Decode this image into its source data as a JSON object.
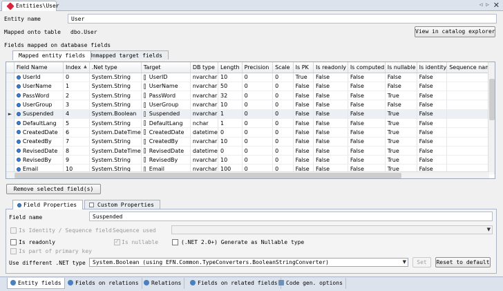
{
  "window": {
    "doc_tab": "Entities\\User",
    "nav_arrows": "◁ ▷",
    "close": "✕"
  },
  "entity": {
    "name_label": "Entity name",
    "name_value": "User",
    "mapped_label": "Mapped onto table",
    "mapped_value": "dbo.User",
    "view_catalog_button": "View in catalog explorer",
    "fields_section_label": "Fields mapped on database fields"
  },
  "field_tabs": [
    "Mapped entity fields",
    "Unmapped target fields"
  ],
  "grid": {
    "columns": [
      "Field Name",
      "Index",
      ".Net type",
      "Target",
      "DB type",
      "Length",
      "Precision",
      "Scale",
      "Is PK",
      "Is readonly",
      "Is computed",
      "Is nullable",
      "Is identity",
      "Sequence name"
    ],
    "sort_indicator": "▲",
    "current_marker": "►",
    "rows": [
      [
        "UserId",
        "0",
        "System.String",
        "UserID",
        "nvarchar",
        "10",
        "0",
        "0",
        "True",
        "False",
        "False",
        "False",
        "False",
        ""
      ],
      [
        "UserName",
        "1",
        "System.String",
        "UserName",
        "nvarchar",
        "50",
        "0",
        "0",
        "False",
        "False",
        "False",
        "False",
        "False",
        ""
      ],
      [
        "PassWord",
        "2",
        "System.String",
        "PassWord",
        "nvarchar",
        "32",
        "0",
        "0",
        "False",
        "False",
        "False",
        "True",
        "False",
        ""
      ],
      [
        "UserGroup",
        "3",
        "System.String",
        "UserGroup",
        "nvarchar",
        "10",
        "0",
        "0",
        "False",
        "False",
        "False",
        "False",
        "False",
        ""
      ],
      [
        "Suspended",
        "4",
        "System.Boolean",
        "Suspended",
        "nvarchar",
        "1",
        "0",
        "0",
        "False",
        "False",
        "False",
        "True",
        "False",
        ""
      ],
      [
        "DefaultLang",
        "5",
        "System.String",
        "DefaultLang",
        "nchar",
        "1",
        "0",
        "0",
        "False",
        "False",
        "False",
        "True",
        "False",
        ""
      ],
      [
        "CreatedDate",
        "6",
        "System.DateTime",
        "CreatedDate",
        "datetime",
        "0",
        "0",
        "0",
        "False",
        "False",
        "False",
        "True",
        "False",
        ""
      ],
      [
        "CreatedBy",
        "7",
        "System.String",
        "CreatedBy",
        "nvarchar",
        "10",
        "0",
        "0",
        "False",
        "False",
        "False",
        "True",
        "False",
        ""
      ],
      [
        "RevisedDate",
        "8",
        "System.DateTime",
        "RevisedDate",
        "datetime",
        "0",
        "0",
        "0",
        "False",
        "False",
        "False",
        "True",
        "False",
        ""
      ],
      [
        "RevisedBy",
        "9",
        "System.String",
        "RevisedBy",
        "nvarchar",
        "10",
        "0",
        "0",
        "False",
        "False",
        "False",
        "True",
        "False",
        ""
      ],
      [
        "Email",
        "10",
        "System.String",
        "Email",
        "nvarchar",
        "100",
        "0",
        "0",
        "False",
        "False",
        "False",
        "True",
        "False",
        ""
      ]
    ],
    "current_row_index": 4
  },
  "remove_button": "Remove selected field(s)",
  "prop_tabs": [
    "Field Properties",
    "Custom Properties"
  ],
  "props": {
    "field_name_label": "Field name",
    "field_name_value": "Suspended",
    "is_identity_label": "Is Identity / Sequence field",
    "sequence_used_label": "Sequence used",
    "is_readonly_label": "Is readonly",
    "is_nullable_label": "Is nullable",
    "net20_label": "(.NET 2.0+) Generate as Nullable type",
    "is_part_pk_label": "Is part of primary key",
    "net_type_label": "Use different .NET type",
    "net_type_value": "System.Boolean (using EFN.Common.TypeConverters.BooleanStringConverter)",
    "set_button": "Set",
    "reset_button": "Reset to default"
  },
  "bottom_tabs": [
    "Entity fields",
    "Fields on relations",
    "Relations",
    "Fields on related fields",
    "Code gen. options"
  ]
}
